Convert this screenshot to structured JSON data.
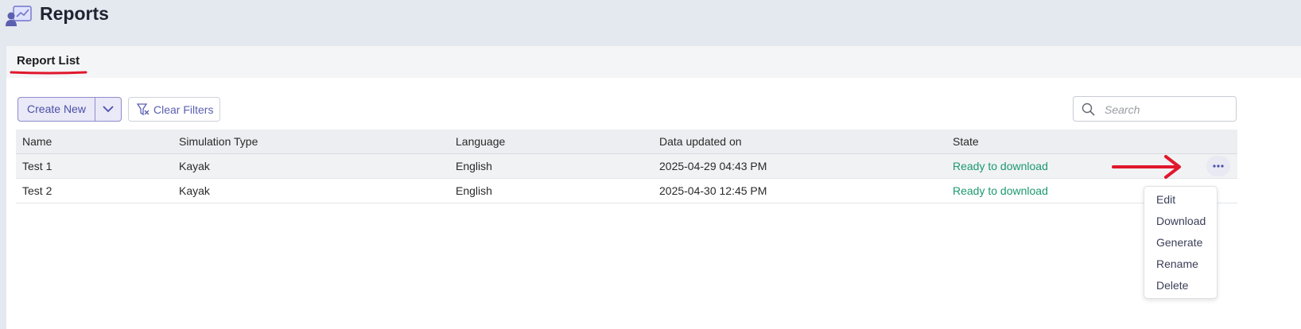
{
  "header": {
    "title": "Reports"
  },
  "tabs": [
    {
      "label": "Report List",
      "active": true
    }
  ],
  "toolbar": {
    "create_new_label": "Create New",
    "clear_filters_label": "Clear Filters",
    "search_placeholder": "Search"
  },
  "table": {
    "columns": [
      "Name",
      "Simulation Type",
      "Language",
      "Data updated on",
      "State"
    ],
    "rows": [
      {
        "name": "Test 1",
        "simulation_type": "Kayak",
        "language": "English",
        "updated": "2025-04-29 04:43 PM",
        "state": "Ready to download"
      },
      {
        "name": "Test 2",
        "simulation_type": "Kayak",
        "language": "English",
        "updated": "2025-04-30 12:45 PM",
        "state": "Ready to download"
      }
    ]
  },
  "row_menu": {
    "items": [
      "Edit",
      "Download",
      "Generate",
      "Rename",
      "Delete"
    ]
  },
  "colors": {
    "accent": "#4b4fa6",
    "state_ready": "#1b9a6e",
    "annotation": "#e0182d"
  },
  "icons": [
    "reports-app-icon",
    "chevron-down-icon",
    "filter-clear-icon",
    "search-icon",
    "more-horizontal-icon",
    "arrow-right-icon"
  ]
}
